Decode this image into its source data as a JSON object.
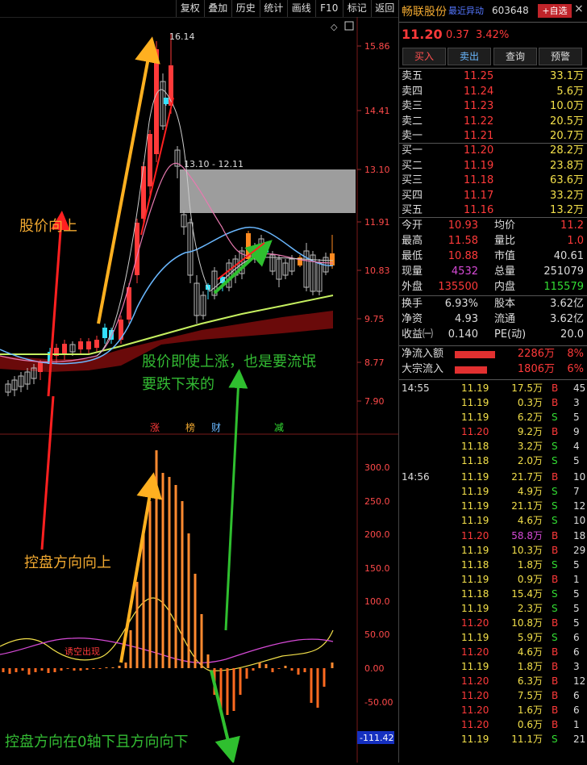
{
  "toolbar": {
    "items": [
      "复权",
      "叠加",
      "历史",
      "统计",
      "画线",
      "F10",
      "标记",
      "返回"
    ]
  },
  "stock": {
    "name": "畅联股份",
    "recent": "最近异动",
    "code": "603648",
    "add": "+自选",
    "price": "11.20",
    "change": "0.37",
    "pct": "3.42%"
  },
  "actions": [
    "买入",
    "卖出",
    "查询",
    "预警"
  ],
  "sell_orders": [
    {
      "label": "卖五",
      "price": "11.25",
      "vol": "33.1万"
    },
    {
      "label": "卖四",
      "price": "11.24",
      "vol": "5.6万"
    },
    {
      "label": "卖三",
      "price": "11.23",
      "vol": "10.0万"
    },
    {
      "label": "卖二",
      "price": "11.22",
      "vol": "20.5万"
    },
    {
      "label": "卖一",
      "price": "11.21",
      "vol": "20.7万"
    }
  ],
  "buy_orders": [
    {
      "label": "买一",
      "price": "11.20",
      "vol": "28.2万"
    },
    {
      "label": "买二",
      "price": "11.19",
      "vol": "23.8万"
    },
    {
      "label": "买三",
      "price": "11.18",
      "vol": "63.6万"
    },
    {
      "label": "买四",
      "price": "11.17",
      "vol": "33.2万"
    },
    {
      "label": "买五",
      "price": "11.16",
      "vol": "13.2万"
    }
  ],
  "quote": {
    "open_l": "今开",
    "open": "10.93",
    "avg_l": "均价",
    "avg": "11.2",
    "high_l": "最高",
    "high": "11.58",
    "ratio_l": "量比",
    "ratio": "1.0",
    "low_l": "最低",
    "low": "10.88",
    "mcap_l": "市值",
    "mcap": "40.61",
    "now_l": "现量",
    "now": "4532",
    "tvol_l": "总量",
    "tvol": "251079",
    "outer_l": "外盘",
    "outer": "135500",
    "inner_l": "内盘",
    "inner": "115579"
  },
  "stats": {
    "turn_l": "换手",
    "turn": "6.93%",
    "cap_l": "股本",
    "cap": "3.62亿",
    "nav_l": "净资",
    "nav": "4.93",
    "flow_l": "流通",
    "flow": "3.62亿",
    "eps_l": "收益㈠",
    "eps": "0.140",
    "pe_l": "PE(动)",
    "pe": "20.0"
  },
  "flows": [
    {
      "label": "净流入额",
      "value": "2286万",
      "pct": "8%"
    },
    {
      "label": "大宗流入",
      "value": "1806万",
      "pct": "6%"
    }
  ],
  "ticks": [
    {
      "time": "14:55",
      "price": "11.19",
      "vol": "17.5万",
      "side": "B",
      "n": "45"
    },
    {
      "time": "",
      "price": "11.19",
      "vol": "0.3万",
      "side": "B",
      "n": "3"
    },
    {
      "time": "",
      "price": "11.19",
      "vol": "6.2万",
      "side": "S",
      "n": "5"
    },
    {
      "time": "",
      "price": "11.20",
      "vol": "9.2万",
      "side": "B",
      "n": "9"
    },
    {
      "time": "",
      "price": "11.18",
      "vol": "3.2万",
      "side": "S",
      "n": "4"
    },
    {
      "time": "",
      "price": "11.18",
      "vol": "2.0万",
      "side": "S",
      "n": "5"
    },
    {
      "time": "14:56",
      "price": "11.19",
      "vol": "21.7万",
      "side": "B",
      "n": "10"
    },
    {
      "time": "",
      "price": "11.19",
      "vol": "4.9万",
      "side": "S",
      "n": "7"
    },
    {
      "time": "",
      "price": "11.19",
      "vol": "21.1万",
      "side": "S",
      "n": "12"
    },
    {
      "time": "",
      "price": "11.19",
      "vol": "4.6万",
      "side": "S",
      "n": "10"
    },
    {
      "time": "",
      "price": "11.20",
      "vol": "58.8万",
      "side": "B",
      "n": "18"
    },
    {
      "time": "",
      "price": "11.19",
      "vol": "10.3万",
      "side": "B",
      "n": "29"
    },
    {
      "time": "",
      "price": "11.18",
      "vol": "1.8万",
      "side": "S",
      "n": "5"
    },
    {
      "time": "",
      "price": "11.19",
      "vol": "0.9万",
      "side": "B",
      "n": "1"
    },
    {
      "time": "",
      "price": "11.18",
      "vol": "15.4万",
      "side": "S",
      "n": "5"
    },
    {
      "time": "",
      "price": "11.19",
      "vol": "2.3万",
      "side": "S",
      "n": "5"
    },
    {
      "time": "",
      "price": "11.20",
      "vol": "10.8万",
      "side": "B",
      "n": "5"
    },
    {
      "time": "",
      "price": "11.19",
      "vol": "5.9万",
      "side": "S",
      "n": "6"
    },
    {
      "time": "",
      "price": "11.20",
      "vol": "4.6万",
      "side": "B",
      "n": "6"
    },
    {
      "time": "",
      "price": "11.19",
      "vol": "1.8万",
      "side": "B",
      "n": "3"
    },
    {
      "time": "",
      "price": "11.20",
      "vol": "6.3万",
      "side": "B",
      "n": "12"
    },
    {
      "time": "",
      "price": "11.20",
      "vol": "7.5万",
      "side": "B",
      "n": "6"
    },
    {
      "time": "",
      "price": "11.20",
      "vol": "1.6万",
      "side": "B",
      "n": "6"
    },
    {
      "time": "",
      "price": "11.20",
      "vol": "0.6万",
      "side": "B",
      "n": "1"
    },
    {
      "time": "",
      "price": "11.19",
      "vol": "11.1万",
      "side": "S",
      "n": "21"
    }
  ],
  "chart": {
    "price_axis": [
      "15.86",
      "14.41",
      "13.10",
      "11.91",
      "10.83",
      "9.75",
      "8.77",
      "7.90"
    ],
    "ind_axis": [
      "300.0",
      "250.0",
      "200.0",
      "150.0",
      "100.0",
      "50.00",
      "0.00",
      "-50.00"
    ],
    "ind_value": "-111.42",
    "max_label": "16.14",
    "zone_label": "13.10 - 12.11",
    "tags": [
      "涨",
      "榜",
      "财",
      "减"
    ],
    "ind_signal": "诱空出现"
  },
  "annotations": {
    "a1": "股价向上",
    "a2": "股价即使上涨，也是要流氓",
    "a3": "要跌下来的",
    "a4": "控盘方向向上",
    "a5": "控盘方向在0轴下且方向向下"
  }
}
